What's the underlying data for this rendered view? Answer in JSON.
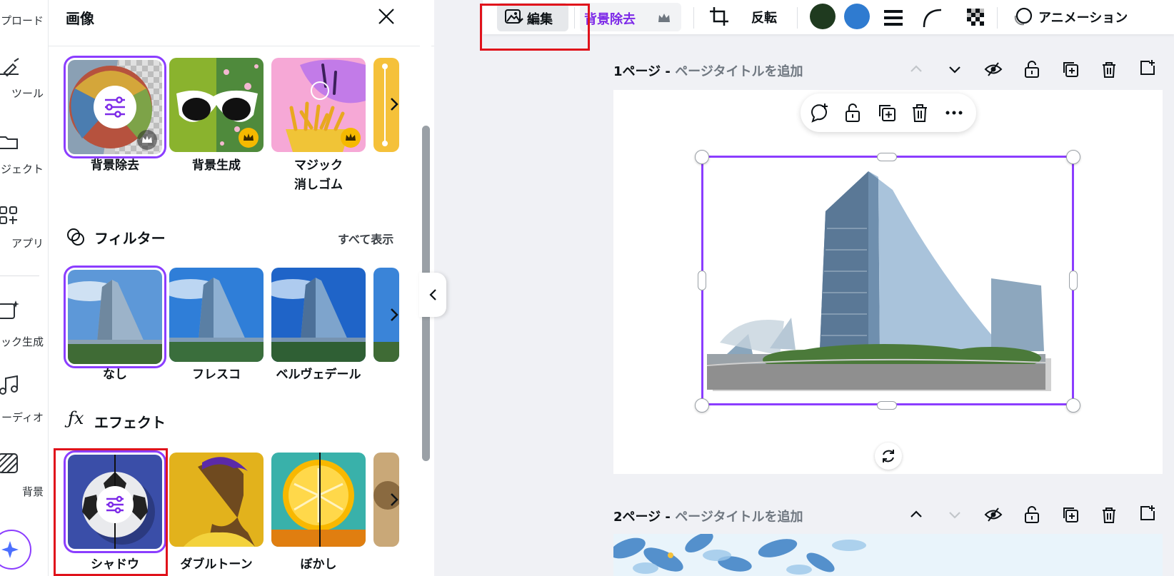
{
  "rail": {
    "items": [
      {
        "label": "プロード"
      },
      {
        "label": "ツール"
      },
      {
        "label": "ジェクト"
      },
      {
        "label": "アプリ"
      },
      {
        "label": "ック生成"
      },
      {
        "label": "ーディオ"
      },
      {
        "label": "背景"
      }
    ]
  },
  "panel": {
    "title": "画像",
    "tools": [
      {
        "label": "背景除去"
      },
      {
        "label": "背景生成"
      },
      {
        "label": "マジック",
        "label2": "消しゴム"
      }
    ],
    "filters": {
      "title": "フィルター",
      "see_all": "すべて表示",
      "items": [
        {
          "label": "なし"
        },
        {
          "label": "フレスコ"
        },
        {
          "label": "ベルヴェデール"
        }
      ]
    },
    "effects": {
      "title": "エフェクト",
      "items": [
        {
          "label": "シャドウ"
        },
        {
          "label": "ダブルトーン"
        },
        {
          "label": "ぼかし"
        }
      ]
    }
  },
  "toolbar": {
    "edit_label": "編集",
    "bg_remove_label": "背景除去",
    "flip_label": "反転",
    "animation_label": "アニメーション",
    "colors": [
      "#1f3a1f",
      "#2f7bd0"
    ]
  },
  "pages": [
    {
      "number_label": "1ページ -",
      "title_placeholder": "ページタイトルを追加"
    },
    {
      "number_label": "2ページ -",
      "title_placeholder": "ページタイトルを追加"
    }
  ],
  "colors": {
    "accent": "#8b3dff",
    "highlight": "#e0121b"
  }
}
